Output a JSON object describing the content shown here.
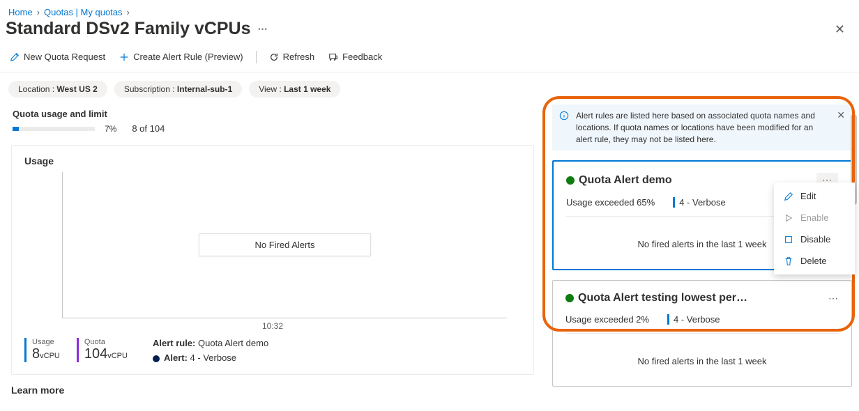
{
  "breadcrumb": {
    "home": "Home",
    "quotas": "Quotas | My quotas"
  },
  "page_title": "Standard DSv2 Family vCPUs",
  "toolbar": {
    "new_request": "New Quota Request",
    "create_alert": "Create Alert Rule (Preview)",
    "refresh": "Refresh",
    "feedback": "Feedback"
  },
  "filters": {
    "location_label": "Location :",
    "location_value": "West US 2",
    "subscription_label": "Subscription :",
    "subscription_value": "Internal-sub-1",
    "view_label": "View :",
    "view_value": "Last 1 week"
  },
  "usage": {
    "section_title": "Quota usage and limit",
    "percent": "7%",
    "ratio": "8 of 104",
    "card_title": "Usage",
    "no_fired": "No Fired Alerts",
    "time_tick": "10:32",
    "usage_label": "Usage",
    "usage_value": "8",
    "usage_unit": "vCPU",
    "quota_label": "Quota",
    "quota_value": "104",
    "quota_unit": "vCPU",
    "rule_label": "Alert rule:",
    "rule_value": "Quota Alert demo",
    "alert_label": "Alert:",
    "alert_value": "4 - Verbose",
    "learn_more": "Learn more"
  },
  "info_banner": "Alert rules are listed here based on associated quota names and locations. If quota names or locations have been modified for an alert rule, they may not be listed here.",
  "alerts": [
    {
      "title": "Quota Alert demo",
      "threshold": "Usage exceeded 65%",
      "severity": "4 - Verbose",
      "no_fired": "No fired alerts in the last 1 week"
    },
    {
      "title": "Quota Alert testing lowest per…",
      "threshold": "Usage exceeded 2%",
      "severity": "4 - Verbose",
      "no_fired": "No fired alerts in the last 1 week"
    }
  ],
  "menu": {
    "edit": "Edit",
    "enable": "Enable",
    "disable": "Disable",
    "delete": "Delete"
  },
  "chart_data": {
    "type": "line",
    "series": [
      {
        "name": "Usage",
        "values": [
          8
        ],
        "unit": "vCPU",
        "color": "#0078d4"
      },
      {
        "name": "Quota",
        "values": [
          104
        ],
        "unit": "vCPU",
        "color": "#8a2be2"
      }
    ],
    "x": [
      "10:32"
    ],
    "title": "Usage",
    "ylabel": "",
    "note": "No Fired Alerts"
  }
}
